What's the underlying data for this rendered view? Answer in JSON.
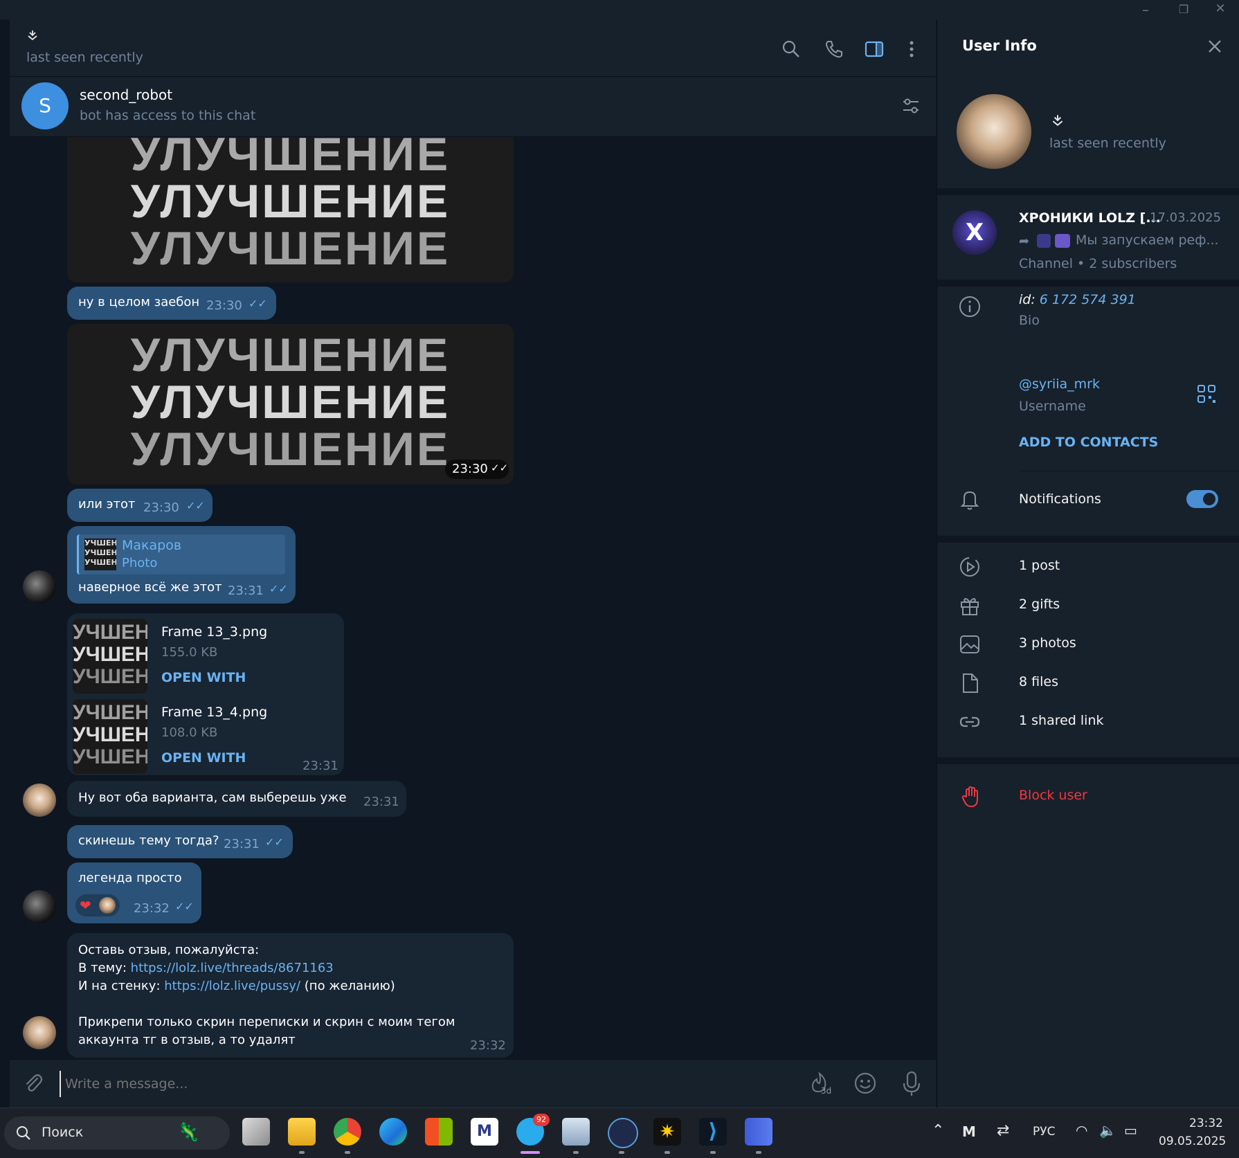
{
  "window": {
    "minimize": "–",
    "restore": "❐",
    "close": "✕"
  },
  "chat_header": {
    "status": "last seen recently"
  },
  "bot_bar": {
    "avatar_letter": "S",
    "name": "second_robot",
    "subtitle": "bot has access to this chat"
  },
  "image_word": "УЛУЧШЕНИЕ",
  "thumb_word": "УЧШЕН",
  "messages": {
    "m1": {
      "text": "ну в целом заебон",
      "time": "23:30"
    },
    "img2_time": "23:30",
    "m3": {
      "text": "или этот",
      "time": "23:30"
    },
    "m4": {
      "reply_author": "Макаров",
      "reply_type": "Photo",
      "text": "наверное всё же этот",
      "time": "23:31"
    },
    "files": [
      {
        "name": "Frame 13_3.png",
        "size": "155.0 KB",
        "action": "OPEN WITH"
      },
      {
        "name": "Frame 13_4.png",
        "size": "108.0 KB",
        "action": "OPEN WITH"
      }
    ],
    "files_time": "23:31",
    "m5": {
      "text": "Ну вот оба варианта, сам выберешь уже",
      "time": "23:31"
    },
    "m6": {
      "text": "скинешь тему тогда?",
      "time": "23:31"
    },
    "m7": {
      "text": "легенда просто",
      "time": "23:32"
    },
    "m8": {
      "line1": "Оставь отзыв, пожалуйста:",
      "line2_prefix": "В тему: ",
      "line2_link": "https://lolz.live/threads/8671163",
      "line3_prefix": "И на стенку: ",
      "line3_link": "https://lolz.live/pussy/",
      "line3_suffix": " (по желанию)",
      "line4": "Прикрепи только скрин переписки и скрин с моим тегом",
      "line5": "аккаунта тг в отзыв, а то удалят",
      "time": "23:32"
    }
  },
  "composer": {
    "placeholder": "Write a message...",
    "timer_label": "3d"
  },
  "panel": {
    "title": "User Info",
    "status": "last seen recently",
    "channel": {
      "name": "ХРОНИКИ LOLZ [...",
      "date": "17.03.2025",
      "preview": "Мы запускаем реф...",
      "meta": "Channel • 2 subscribers"
    },
    "id_label": "id: ",
    "id_value": "6 172 574 391",
    "bio_label": "Bio",
    "username": "@syriia_mrk",
    "username_label": "Username",
    "add_contacts": "ADD TO CONTACTS",
    "notifications": "Notifications",
    "notifications_on": true,
    "stats": [
      "1 post",
      "2 gifts",
      "3 photos",
      "8 files",
      "1 shared link"
    ],
    "block": "Block user"
  },
  "taskbar": {
    "search": "Поиск",
    "lang": "РУС",
    "time": "23:32",
    "date": "09.05.2025",
    "telegram_badge": "92"
  },
  "colors": {
    "accent": "#6ab3f3",
    "outgoing": "#2b5278",
    "incoming": "#182533",
    "danger": "#ec3942"
  }
}
